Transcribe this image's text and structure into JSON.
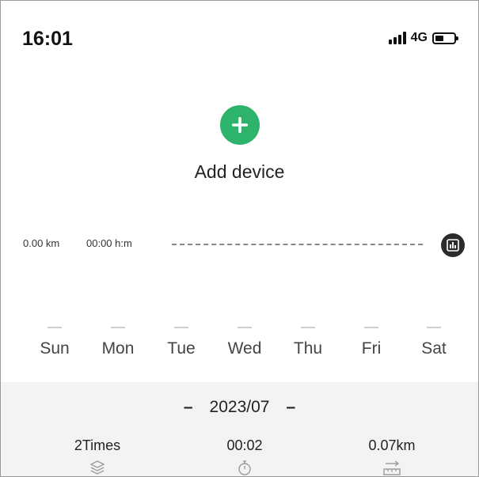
{
  "status_bar": {
    "time": "16:01",
    "network": "4G",
    "battery_level": 0.45
  },
  "add_device": {
    "label": "Add device"
  },
  "summary": {
    "distance": "0.00 km",
    "duration": "00:00 h:m"
  },
  "week": {
    "days": [
      {
        "label": "Sun"
      },
      {
        "label": "Mon"
      },
      {
        "label": "Tue"
      },
      {
        "label": "Wed"
      },
      {
        "label": "Thu"
      },
      {
        "label": "Fri"
      },
      {
        "label": "Sat"
      }
    ]
  },
  "stats": {
    "prev_symbol": "–",
    "next_symbol": "–",
    "month": "2023/07",
    "times": "2Times",
    "duration": "00:02",
    "distance": "0.07km"
  },
  "colors": {
    "accent": "#2db36b",
    "chart_button": "#2b2b2b",
    "panel_bg": "#f3f3f3"
  }
}
